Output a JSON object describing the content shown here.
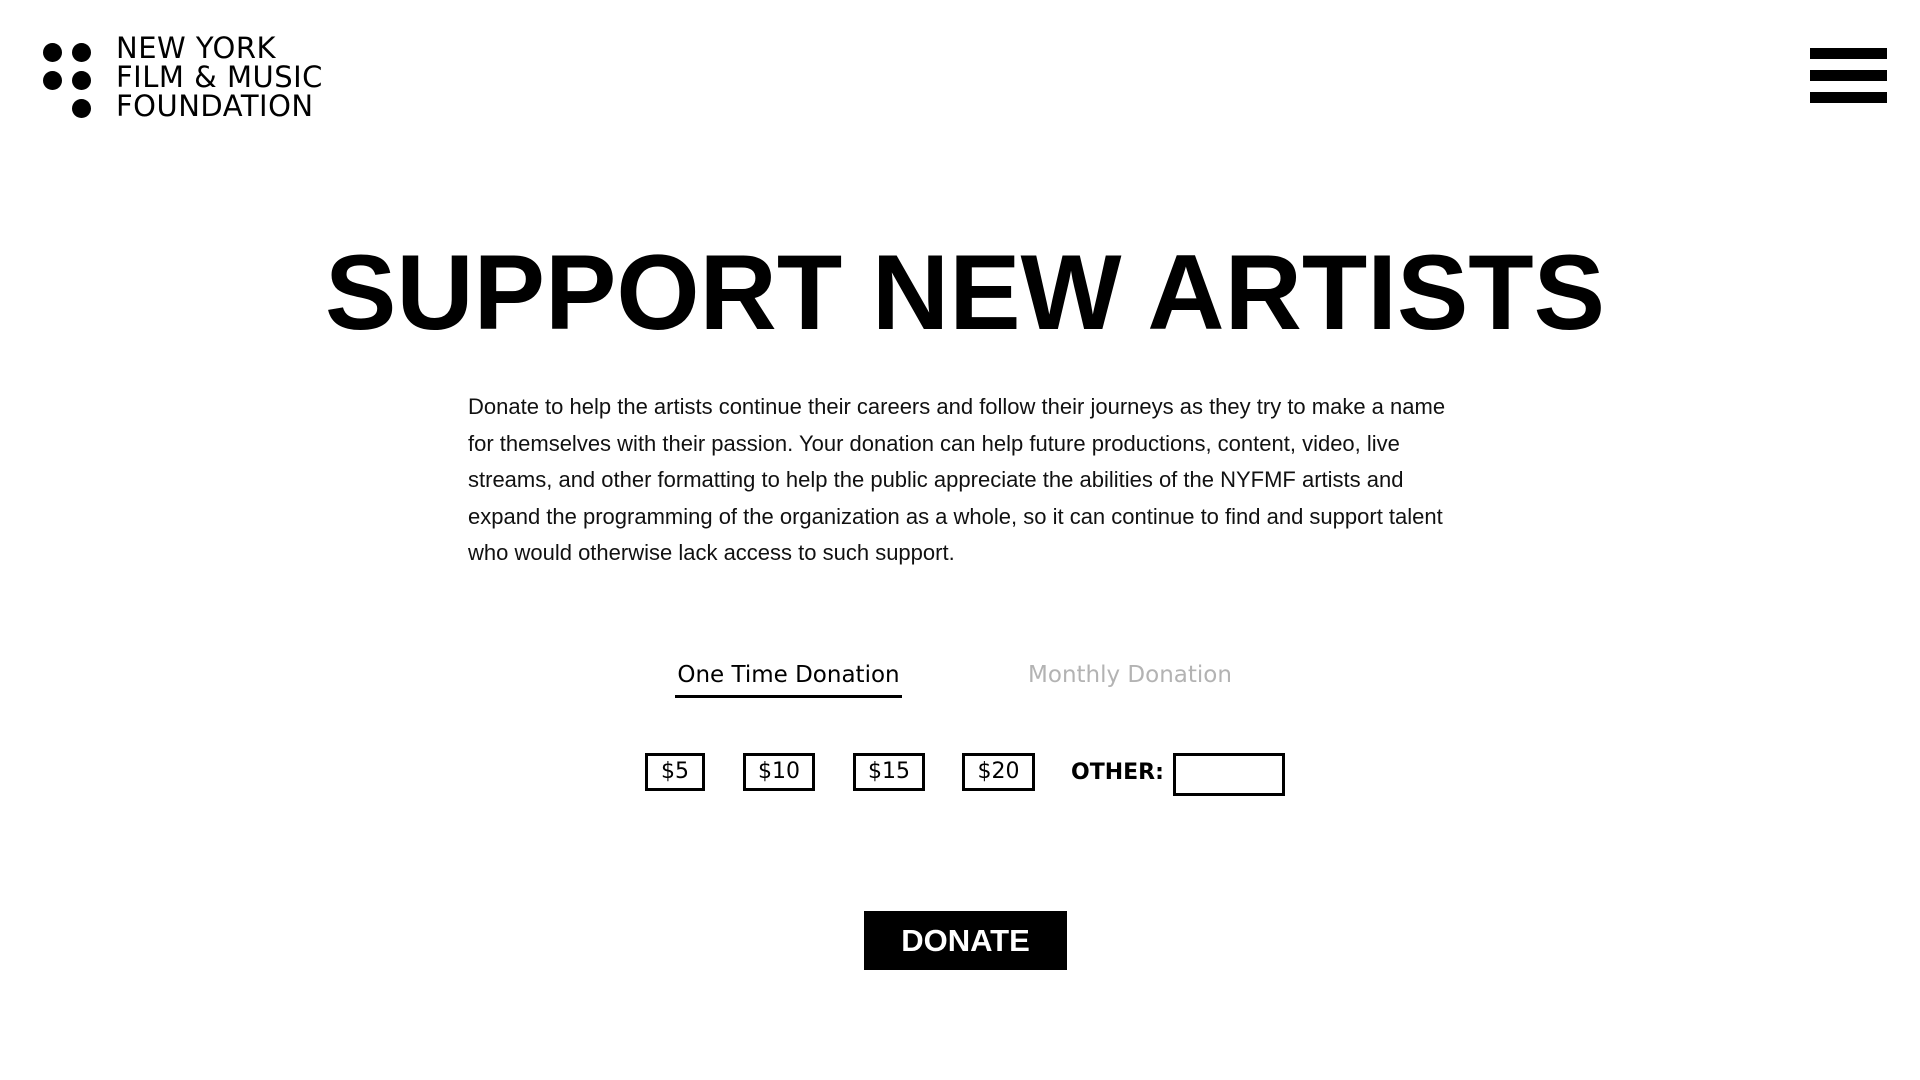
{
  "header": {
    "logo_lines": [
      "NEW YORK",
      "FILM & MUSIC",
      "FOUNDATION"
    ],
    "menu_icon": "hamburger-menu-icon"
  },
  "hero": {
    "title": "SUPPORT NEW ARTISTS",
    "description": "Donate to help the artists continue their careers and follow their journeys as they try to make a name for themselves with their passion. Your donation can help future productions, content, video, live streams, and other formatting to help the public appreciate the abilities of the NYFMF artists and expand the programming of the organization as a whole, so it can continue to find and support talent who would otherwise lack access to such support."
  },
  "tabs": [
    {
      "label": "One Time Donation",
      "active": true
    },
    {
      "label": "Monthly Donation",
      "active": false
    }
  ],
  "amounts": [
    "$5",
    "$10",
    "$15",
    "$20"
  ],
  "other": {
    "label": "OTHER:",
    "value": ""
  },
  "donate_label": "DONATE",
  "colors": {
    "text": "#000000",
    "inactive_tab": "#b3b3b3",
    "background": "#ffffff"
  }
}
